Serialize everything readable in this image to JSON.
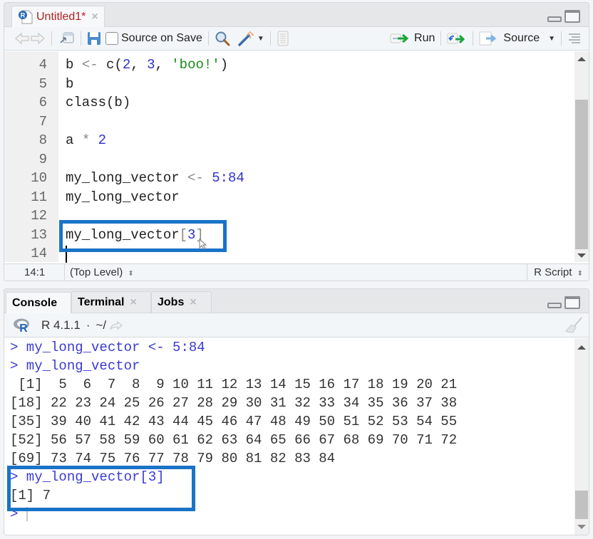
{
  "editor": {
    "tab": {
      "title": "Untitled1*",
      "icon": "r-file-icon",
      "close": "×"
    },
    "toolbar": {
      "source_on_save_label": "Source on Save",
      "source_on_save_checked": false,
      "run_label": "Run",
      "source_label": "Source"
    },
    "lines": [
      {
        "num": "4",
        "tokens": [
          {
            "t": "b ",
            "c": ""
          },
          {
            "t": "<-",
            "c": "kw-op"
          },
          {
            "t": " c(",
            "c": ""
          },
          {
            "t": "2",
            "c": "kw-num"
          },
          {
            "t": ", ",
            "c": ""
          },
          {
            "t": "3",
            "c": "kw-num"
          },
          {
            "t": ", ",
            "c": ""
          },
          {
            "t": "'boo!'",
            "c": "kw-str"
          },
          {
            "t": ")",
            "c": ""
          }
        ]
      },
      {
        "num": "5",
        "tokens": [
          {
            "t": "b",
            "c": ""
          }
        ]
      },
      {
        "num": "6",
        "tokens": [
          {
            "t": "class(b)",
            "c": ""
          }
        ]
      },
      {
        "num": "7",
        "tokens": []
      },
      {
        "num": "8",
        "tokens": [
          {
            "t": "a ",
            "c": ""
          },
          {
            "t": "*",
            "c": "kw-op"
          },
          {
            "t": " ",
            "c": ""
          },
          {
            "t": "2",
            "c": "kw-num"
          }
        ]
      },
      {
        "num": "9",
        "tokens": []
      },
      {
        "num": "10",
        "tokens": [
          {
            "t": "my_long_vector ",
            "c": ""
          },
          {
            "t": "<-",
            "c": "kw-op"
          },
          {
            "t": " ",
            "c": ""
          },
          {
            "t": "5:84",
            "c": "kw-num"
          }
        ]
      },
      {
        "num": "11",
        "tokens": [
          {
            "t": "my_long_vector",
            "c": ""
          }
        ]
      },
      {
        "num": "12",
        "tokens": []
      },
      {
        "num": "13",
        "tokens": [
          {
            "t": "my_long_vector",
            "c": ""
          },
          {
            "t": "[",
            "c": "kw-br"
          },
          {
            "t": "3",
            "c": "kw-num"
          },
          {
            "t": "]",
            "c": "kw-br"
          }
        ]
      },
      {
        "num": "14",
        "tokens": []
      }
    ],
    "status": {
      "position": "14:1",
      "scope": "(Top Level)",
      "file_type": "R Script"
    }
  },
  "console": {
    "tabs": [
      {
        "label": "Console",
        "active": true,
        "closable": false
      },
      {
        "label": "Terminal",
        "active": false,
        "closable": true
      },
      {
        "label": "Jobs",
        "active": false,
        "closable": true
      }
    ],
    "r_version": "R 4.1.1",
    "working_dir": "~/",
    "separator": "·",
    "output": [
      {
        "type": "input",
        "text": "> my_long_vector <- 5:84"
      },
      {
        "type": "input",
        "text": "> my_long_vector"
      },
      {
        "type": "output",
        "text": " [1]  5  6  7  8  9 10 11 12 13 14 15 16 17 18 19 20 21"
      },
      {
        "type": "output",
        "text": "[18] 22 23 24 25 26 27 28 29 30 31 32 33 34 35 36 37 38"
      },
      {
        "type": "output",
        "text": "[35] 39 40 41 42 43 44 45 46 47 48 49 50 51 52 53 54 55"
      },
      {
        "type": "output",
        "text": "[52] 56 57 58 59 60 61 62 63 64 65 66 67 68 69 70 71 72"
      },
      {
        "type": "output",
        "text": "[69] 73 74 75 76 77 78 79 80 81 82 83 84"
      },
      {
        "type": "input",
        "text": "> my_long_vector[3]"
      },
      {
        "type": "output",
        "text": "[1] 7"
      },
      {
        "type": "prompt",
        "text": "> "
      }
    ]
  },
  "colors": {
    "highlight": "#1a73c8",
    "tab_title": "#b22222",
    "console_input": "#3a3ad0"
  }
}
